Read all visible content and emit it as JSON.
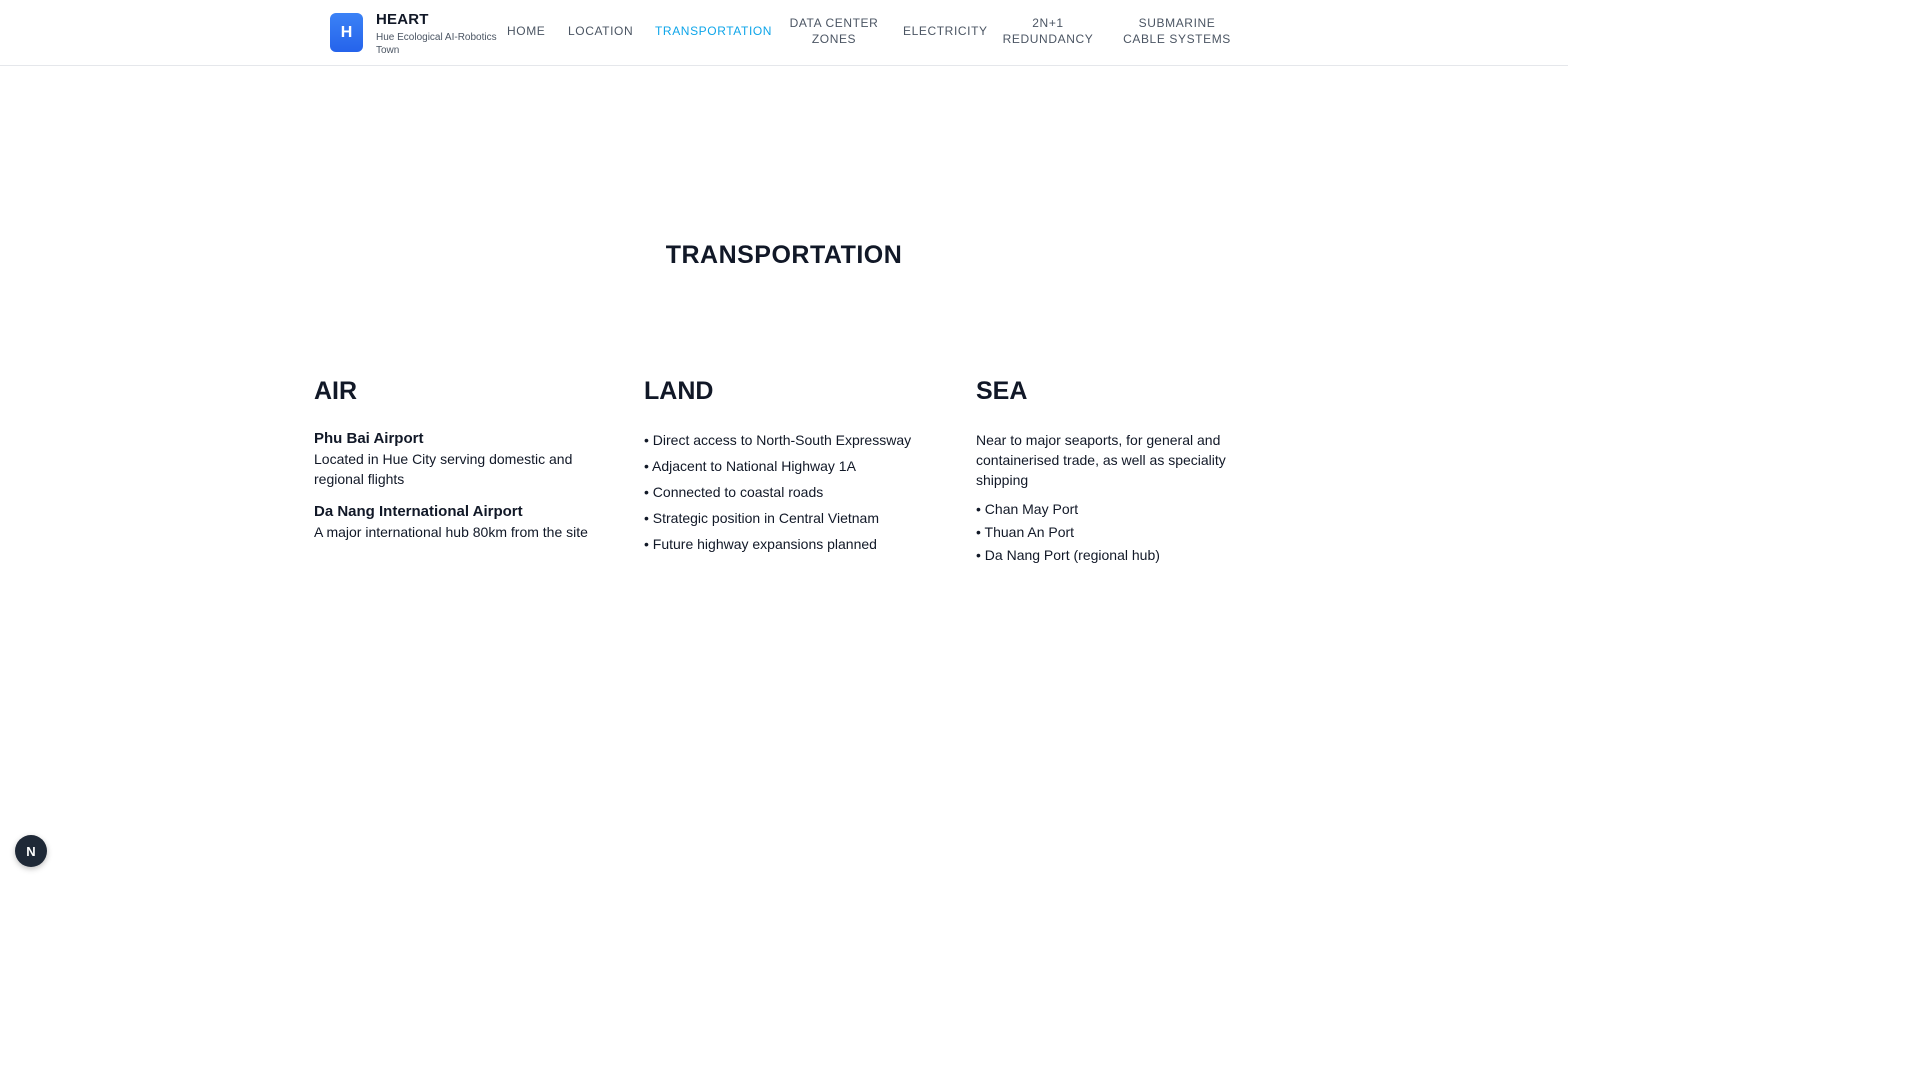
{
  "brand": {
    "logo_letter": "H",
    "title": "HEART",
    "subtitle": "Hue Ecological AI-Robotics Town"
  },
  "nav": {
    "items": [
      {
        "label": "HOME"
      },
      {
        "label": "LOCATION"
      },
      {
        "label": "TRANSPORTATION",
        "active": true
      },
      {
        "label": "DATA CENTER ZONES"
      },
      {
        "label": "ELECTRICITY"
      },
      {
        "label": "2N+1 REDUNDANCY"
      },
      {
        "label": "SUBMARINE CABLE SYSTEMS"
      }
    ],
    "active_color": "#0ea5e9"
  },
  "page": {
    "title": "TRANSPORTATION"
  },
  "air": {
    "heading": "AIR",
    "items": [
      {
        "title": "Phu Bai Airport",
        "desc": "Located in Hue City serving domestic and regional flights"
      },
      {
        "title": "Da Nang International Airport",
        "desc": "A major international hub 80km from the site"
      }
    ]
  },
  "land": {
    "heading": "LAND",
    "bullets": [
      "• Direct access to North-South Expressway",
      "• Adjacent to National Highway 1A",
      "• Connected to coastal roads",
      "• Strategic position in Central Vietnam",
      "• Future highway expansions planned"
    ]
  },
  "sea": {
    "heading": "SEA",
    "intro": "Near to major seaports, for general and containerised trade, as well as speciality shipping",
    "bullets": [
      "• Chan May Port",
      "• Thuan An Port",
      "• Da Nang Port (regional hub)"
    ]
  },
  "badge": {
    "letter": "N"
  }
}
